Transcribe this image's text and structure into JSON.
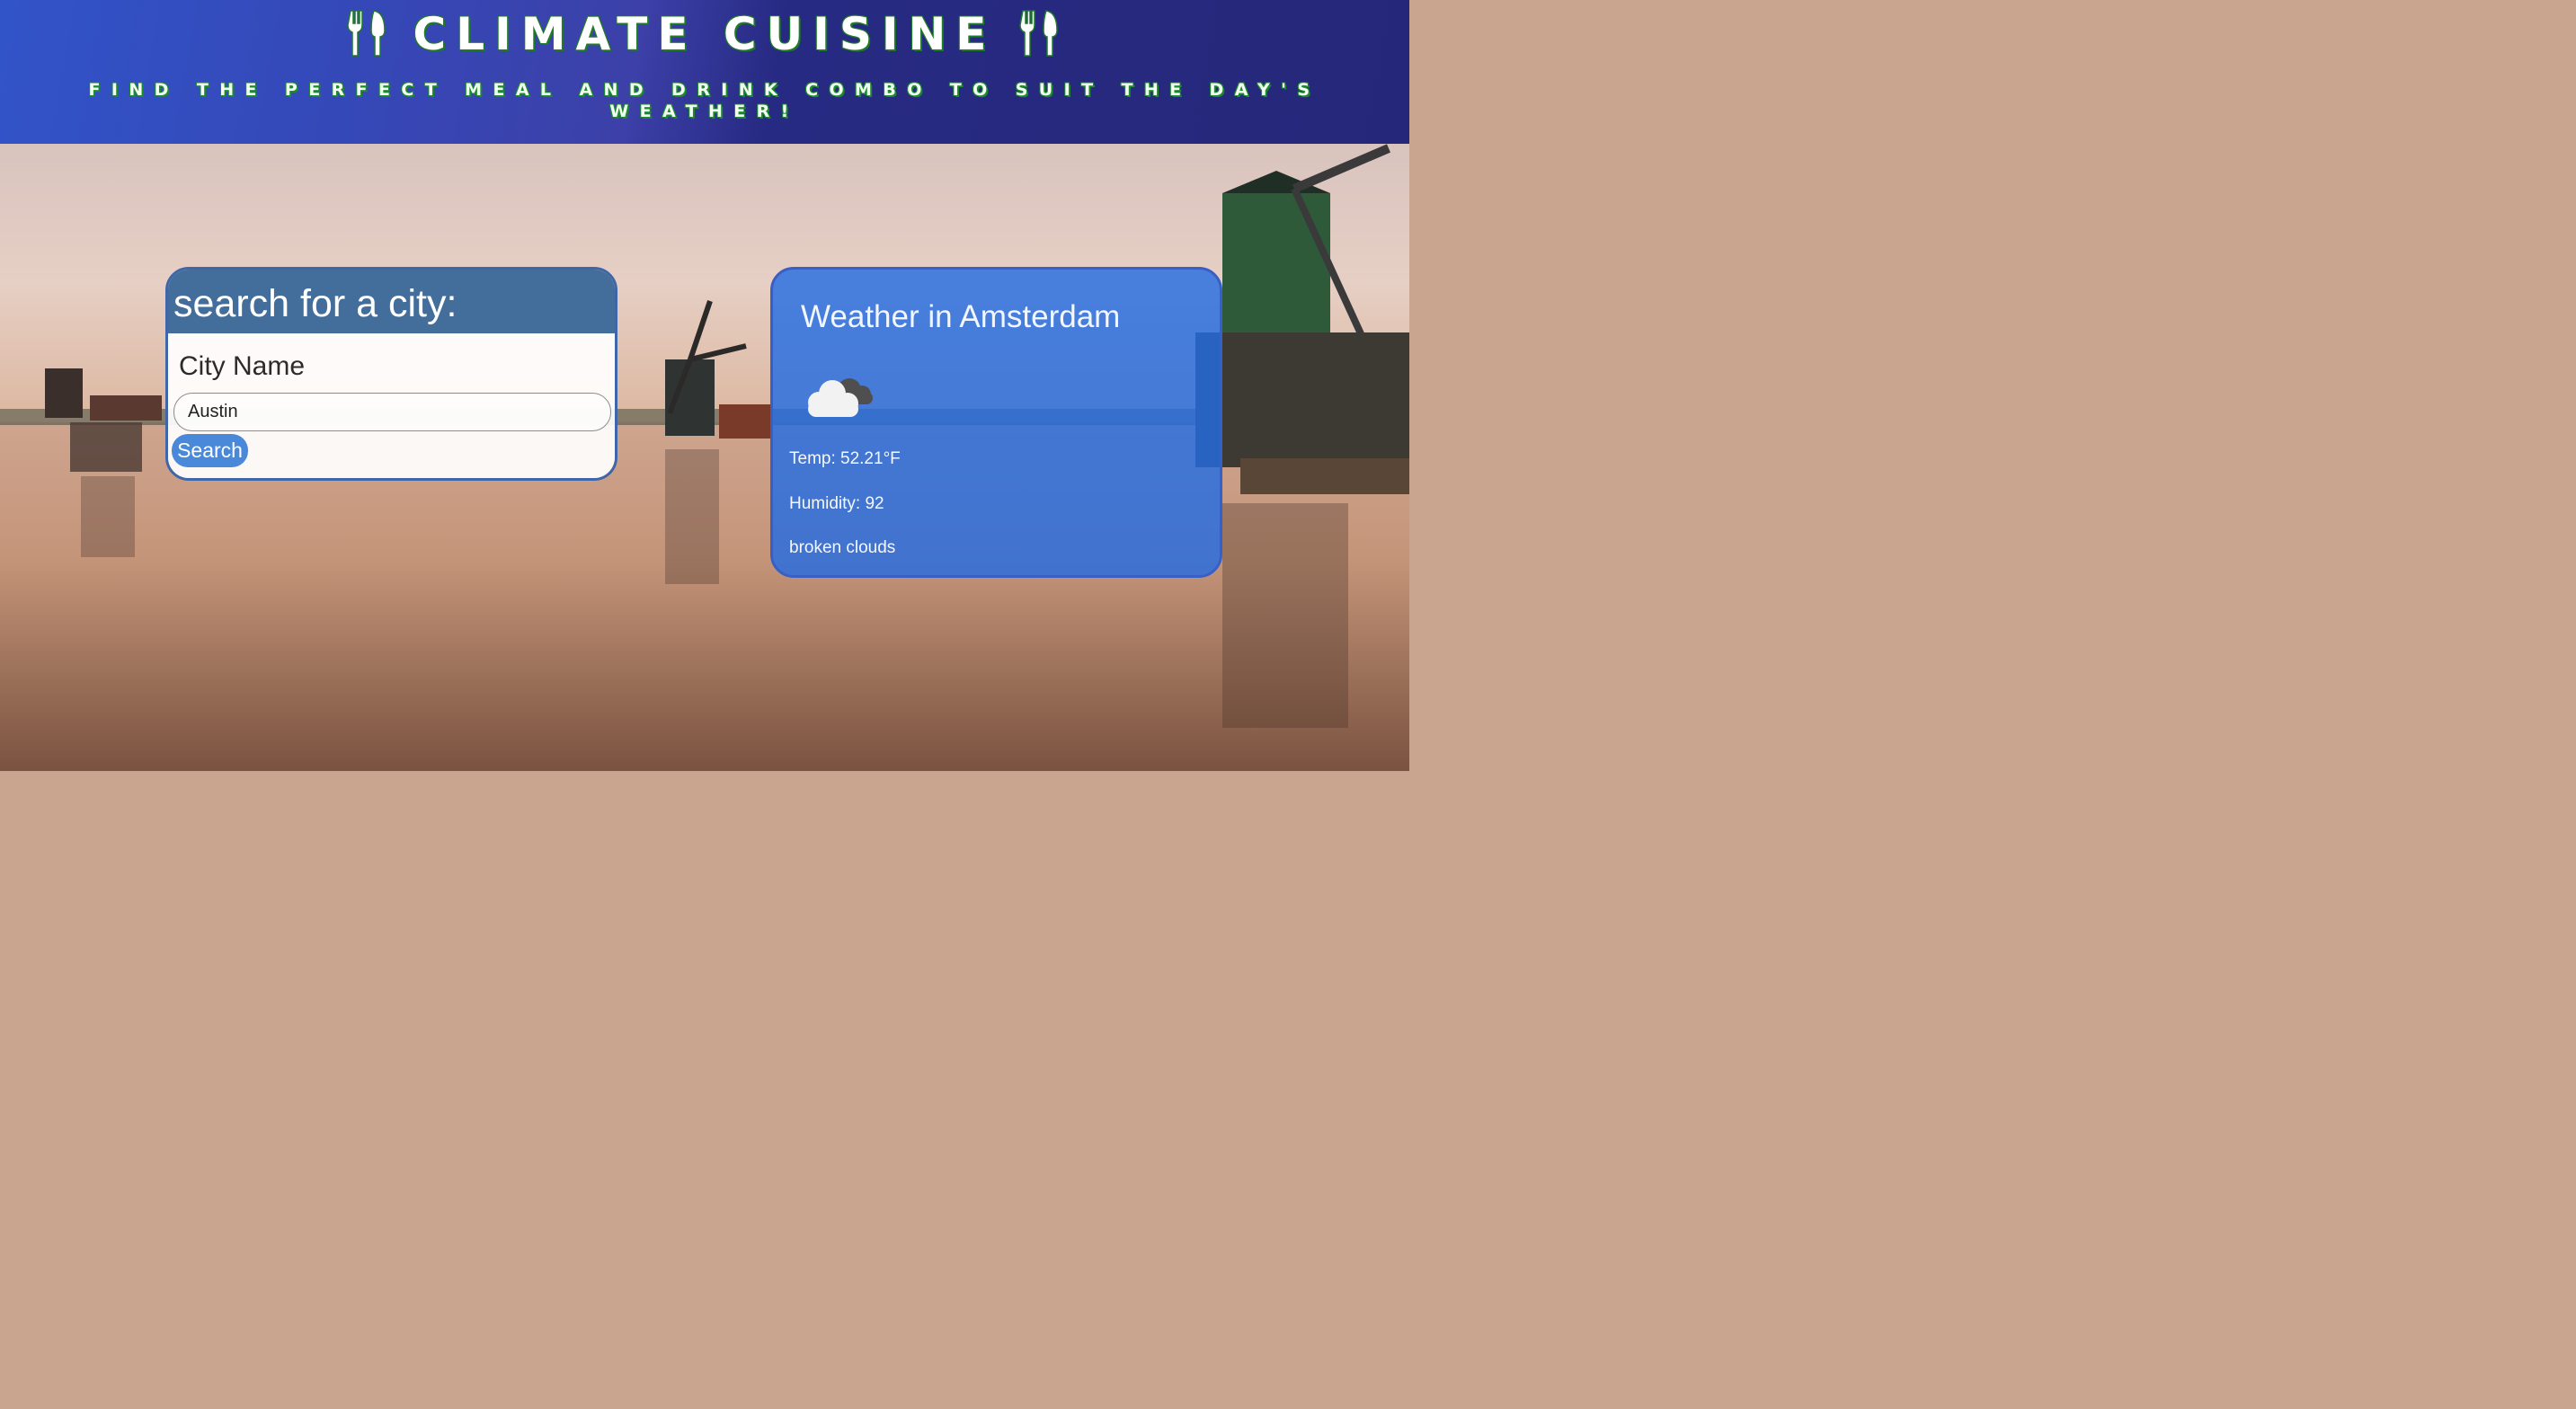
{
  "header": {
    "title": "CLIMATE CUISINE",
    "tagline": "FIND THE PERFECT MEAL AND DRINK COMBO TO SUIT THE DAY'S WEATHER!",
    "icon": "utensils-icon",
    "colors": {
      "gradient_start": "#3154c8",
      "gradient_end": "#25287a",
      "title_outline": "#1f7a2a"
    }
  },
  "search": {
    "heading": "search for a city:",
    "field_label": "City Name",
    "input_value": "Austin",
    "button_label": "Search",
    "colors": {
      "heading_bg": "#436d9a",
      "button_bg": "#4a88d9"
    }
  },
  "weather": {
    "title": "Weather in Amsterdam",
    "icon": "broken-clouds-icon",
    "temp": "Temp: 52.21°F",
    "humidity": "Humidity: 92",
    "description": "broken clouds",
    "colors": {
      "card_bg": "#246ce2"
    }
  }
}
